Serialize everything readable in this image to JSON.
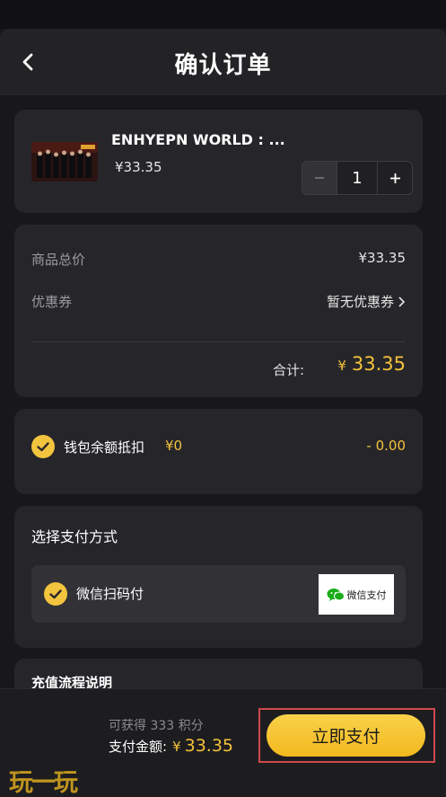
{
  "header": {
    "title": "确认订单"
  },
  "product": {
    "title": "ENHYEPN WORLD : ...",
    "price": "¥33.35",
    "quantity": "1"
  },
  "summary": {
    "subtotal_label": "商品总价",
    "subtotal_value": "¥33.35",
    "coupon_label": "优惠券",
    "coupon_value": "暂无优惠券",
    "total_label": "合计:",
    "total_currency": "¥",
    "total_amount": "33.35"
  },
  "wallet": {
    "label": "钱包余额抵扣",
    "balance": "¥0",
    "deduction": "- 0.00"
  },
  "payment": {
    "section_title": "选择支付方式",
    "option_label": "微信扫码付",
    "badge_text": "微信支付"
  },
  "recharge": {
    "title": "充值流程说明"
  },
  "footer": {
    "points_text": "可获得 333 积分",
    "amount_label": "支付金额:",
    "amount_currency": "¥",
    "amount_value": "33.35",
    "pay_button": "立即支付",
    "watermark": "玩一玩"
  },
  "colors": {
    "accent": "#f5c23a",
    "background": "#18181a",
    "card": "#26262a",
    "highlight_border": "#d0484d"
  },
  "icons": [
    "chevron-left-icon",
    "chevron-right-icon",
    "check-icon",
    "wechat-icon"
  ]
}
